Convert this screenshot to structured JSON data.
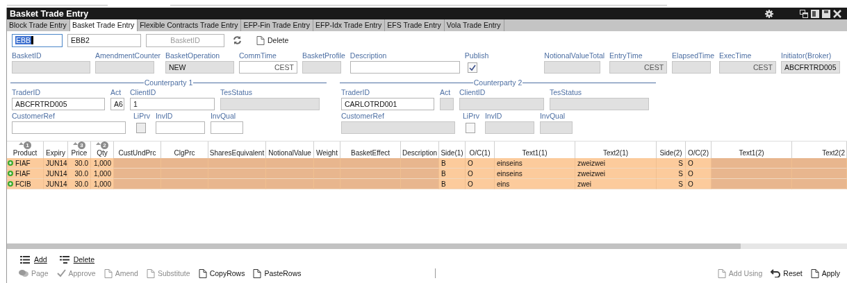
{
  "window": {
    "title": "Basket Trade Entry"
  },
  "tabs": [
    {
      "label": "Block Trade Entry",
      "selected": false
    },
    {
      "label": "Basket Trade Entry",
      "selected": true
    },
    {
      "label": "Flexible Contracts Trade Entry",
      "selected": false
    },
    {
      "label": "EFP-Fin Trade Entry",
      "selected": false
    },
    {
      "label": "EFP-Idx Trade Entry",
      "selected": false
    },
    {
      "label": "EFS Trade Entry",
      "selected": false
    },
    {
      "label": "Vola Trade Entry",
      "selected": false
    }
  ],
  "header_row": {
    "fields": [
      {
        "value": "EBB",
        "focused": true
      },
      {
        "value": "EBB2",
        "focused": false
      },
      {
        "placeholder": "BasketID",
        "focused": false
      }
    ],
    "delete_button": "Delete"
  },
  "basket_fields": [
    {
      "kind": "text",
      "label": "BasketID",
      "disabled": true
    },
    {
      "kind": "text",
      "label": "AmendmentCounter",
      "disabled": true
    },
    {
      "kind": "text",
      "label": "BasketOperation",
      "value": "NEW",
      "disabled": true
    },
    {
      "kind": "text",
      "label": "CommTime",
      "value": "CEST",
      "disabled": false
    },
    {
      "kind": "text",
      "label": "BasketProfile",
      "disabled": true
    },
    {
      "kind": "text",
      "label": "Description",
      "disabled": false
    },
    {
      "kind": "checkbox",
      "label": "Publish",
      "checked": true
    },
    {
      "kind": "text",
      "label": "NotionalValueTotal",
      "disabled": true
    },
    {
      "kind": "text",
      "label": "EntryTime",
      "value": "CEST",
      "disabled": true
    },
    {
      "kind": "text",
      "label": "ElapsedTime",
      "disabled": true
    },
    {
      "kind": "text",
      "label": "ExecTime",
      "value": "CEST",
      "disabled": true
    },
    {
      "kind": "text",
      "label": "Initiator(Broker)",
      "value": "ABCFRTRD005",
      "disabled": true
    }
  ],
  "counterparties": [
    {
      "title": "Counterparty 1",
      "trader_fields": [
        {
          "kind": "text",
          "label": "TraderID",
          "value": "ABCFRTRD005",
          "disabled": false
        },
        {
          "kind": "text",
          "label": "Act",
          "value": "A6",
          "disabled": false
        },
        {
          "kind": "text",
          "label": "ClientID",
          "value": "1",
          "disabled": false
        },
        {
          "kind": "text",
          "label": "TesStatus",
          "disabled": true
        }
      ],
      "reference_fields": [
        {
          "kind": "text",
          "label": "CustomerRef",
          "disabled": false
        },
        {
          "kind": "checkbox",
          "label": "LiPrv",
          "checked": false,
          "disabled": true
        },
        {
          "kind": "text",
          "label": "InvID",
          "disabled": false
        },
        {
          "kind": "text",
          "label": "InvQual",
          "disabled": false
        }
      ]
    },
    {
      "title": "Counterparty 2",
      "trader_fields": [
        {
          "kind": "text",
          "label": "TraderID",
          "value": "CARLOTRD001",
          "disabled": false
        },
        {
          "kind": "text",
          "label": "Act",
          "disabled": true
        },
        {
          "kind": "text",
          "label": "ClientID",
          "disabled": true
        },
        {
          "kind": "text",
          "label": "TesStatus",
          "disabled": true
        }
      ],
      "reference_fields": [
        {
          "kind": "text",
          "label": "CustomerRef",
          "disabled": true
        },
        {
          "kind": "checkbox",
          "label": "LiPrv",
          "checked": false,
          "disabled": false
        },
        {
          "kind": "text",
          "label": "InvID",
          "disabled": true
        },
        {
          "kind": "text",
          "label": "InvQual",
          "disabled": true
        }
      ]
    }
  ],
  "table": {
    "columns": [
      {
        "label": "Product",
        "sort_rank": "1",
        "readonly": false
      },
      {
        "label": "Expiry",
        "readonly": false
      },
      {
        "label": "Price",
        "sort_rank": "3",
        "readonly": false
      },
      {
        "label": "Qty",
        "sort_rank": "2",
        "readonly": false
      },
      {
        "label": "CustUndPrc",
        "readonly": true
      },
      {
        "label": "ClgPrc",
        "readonly": true
      },
      {
        "label": "SharesEquivalent",
        "readonly": true
      },
      {
        "label": "NotionalValue",
        "readonly": true
      },
      {
        "label": "Weight",
        "readonly": true
      },
      {
        "label": "BasketEffect",
        "readonly": true
      },
      {
        "label": "Description",
        "readonly": true
      },
      {
        "label": "Side(1)",
        "readonly": false
      },
      {
        "label": "O/C(1)",
        "readonly": false
      },
      {
        "label": "Text1(1)",
        "readonly": false
      },
      {
        "label": "Text2(1)",
        "readonly": false
      },
      {
        "label": "Side(2)",
        "readonly": false
      },
      {
        "label": "O/C(2)",
        "readonly": false
      },
      {
        "label": "Text1(2)",
        "readonly": true
      },
      {
        "label": "Text2(2",
        "readonly": true
      }
    ],
    "rows": [
      {
        "cells": [
          "FIAF",
          "JUN14",
          "30.0",
          "1,000",
          null,
          null,
          null,
          null,
          null,
          null,
          null,
          "B",
          "O",
          "einseins",
          "zweizwei",
          "S",
          "O",
          null,
          null
        ]
      },
      {
        "cells": [
          "FIAF",
          "JUN14",
          "30.0",
          "1,000",
          null,
          null,
          null,
          null,
          null,
          null,
          null,
          "B",
          "O",
          "einseins",
          "zweizwei",
          "S",
          "O",
          null,
          null
        ]
      },
      {
        "cells": [
          "FCIB",
          "JUN14",
          "30.0",
          "1,000",
          null,
          null,
          null,
          null,
          null,
          null,
          null,
          "B",
          "O",
          "eins",
          "zwei",
          "S",
          "O",
          null,
          null
        ]
      }
    ]
  },
  "row_actions": [
    {
      "kind": "add",
      "label": "Add"
    },
    {
      "kind": "delete",
      "label": "Delete"
    }
  ],
  "toolbar": {
    "left": [
      {
        "kind": "page",
        "label": "Page",
        "disabled": true
      },
      {
        "kind": "approve",
        "label": "Approve",
        "disabled": true
      },
      {
        "kind": "amend",
        "label": "Amend",
        "disabled": true
      },
      {
        "kind": "substitute",
        "label": "Substitute",
        "disabled": true
      },
      {
        "kind": "copy",
        "label": "CopyRows",
        "disabled": false
      },
      {
        "kind": "paste",
        "label": "PasteRows",
        "disabled": false
      }
    ],
    "right": [
      {
        "kind": "addusing",
        "label": "Add Using",
        "disabled": true
      },
      {
        "kind": "reset",
        "label": "Reset",
        "disabled": false
      },
      {
        "kind": "apply",
        "label": "Apply",
        "disabled": false
      }
    ]
  }
}
